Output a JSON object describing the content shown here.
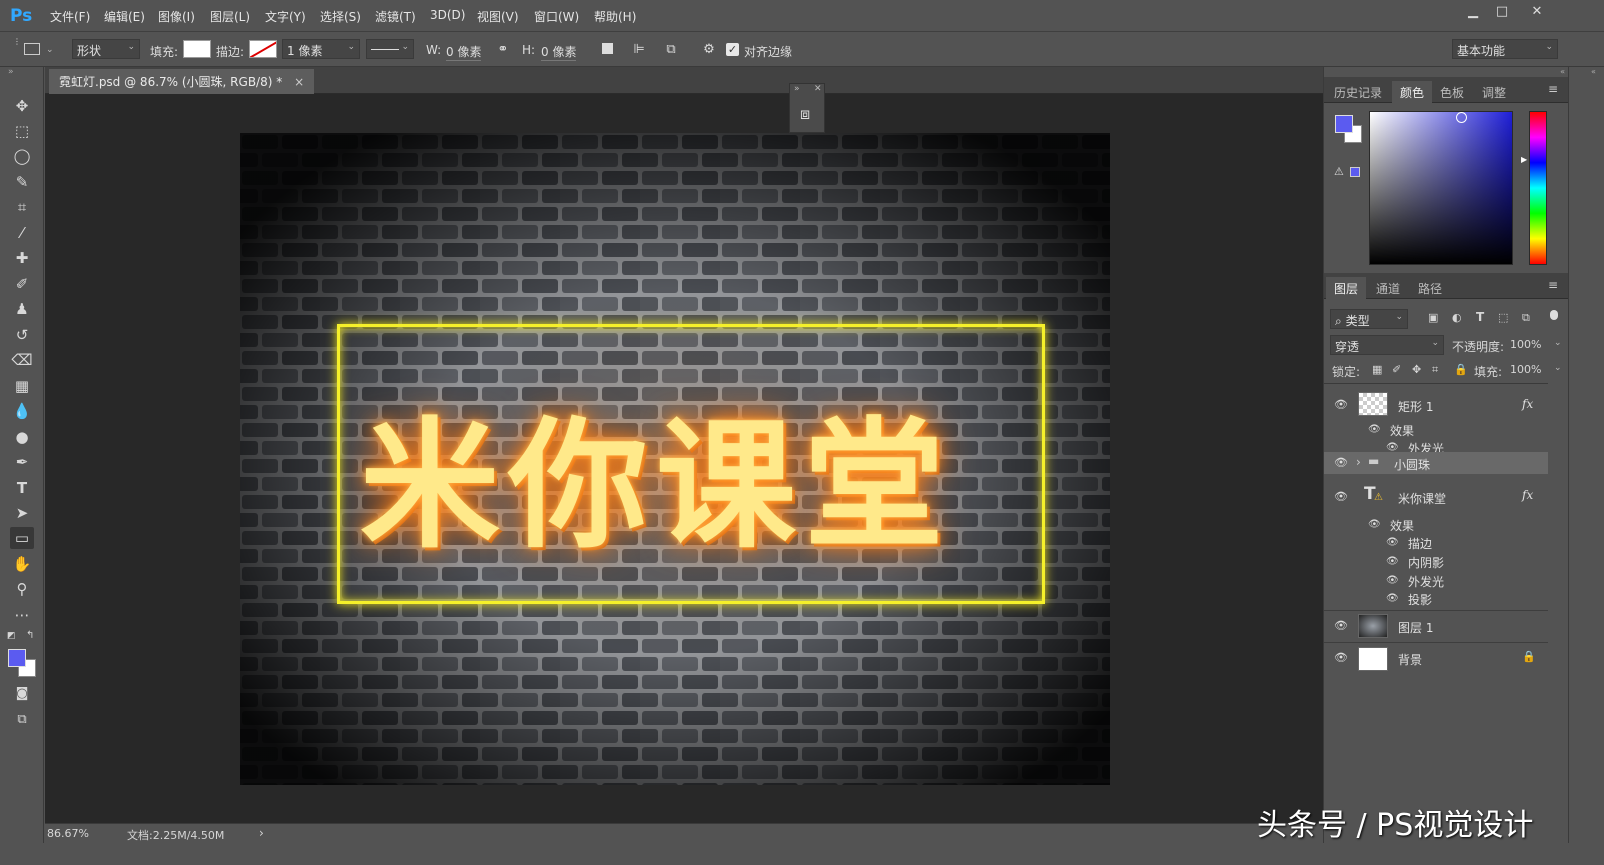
{
  "app": {
    "logo": "Ps"
  },
  "menu": [
    "文件(F)",
    "编辑(E)",
    "图像(I)",
    "图层(L)",
    "文字(Y)",
    "选择(S)",
    "滤镜(T)",
    "3D(D)",
    "视图(V)",
    "窗口(W)",
    "帮助(H)"
  ],
  "window_controls": {
    "minimize": "▁",
    "maximize": "□",
    "close": "✕"
  },
  "options": {
    "shape_mode": "形状",
    "fill_label": "填充:",
    "stroke_label": "描边:",
    "stroke_width": "1 像素",
    "w_label": "W:",
    "w_value": "0 像素",
    "h_label": "H:",
    "h_value": "0 像素",
    "align_edges": "对齐边缘",
    "workspace": "基本功能"
  },
  "document": {
    "tab_title": "霓虹灯.psd @ 86.7% (小圆珠, RGB/8) *",
    "tab_close": "×",
    "canvas_text": "米你课堂",
    "zoom": "86.67%",
    "doc_size": "文档:2.25M/4.50M",
    "status_arrow": "›"
  },
  "panels": {
    "top_tabs": [
      "历史记录",
      "颜色",
      "色板",
      "调整"
    ],
    "layer_tabs": [
      "图层",
      "通道",
      "路径"
    ],
    "filter_kind": "类型",
    "blend_mode": "穿透",
    "opacity_label": "不透明度:",
    "opacity_value": "100%",
    "lock_label": "锁定:",
    "fill_label": "填充:",
    "fill_value": "100%"
  },
  "layers": {
    "rect": {
      "name": "矩形 1",
      "fx": "fx",
      "effects_label": "效果",
      "effects": [
        "外发光"
      ]
    },
    "group": {
      "name": "小圆珠",
      "chevron": "›"
    },
    "text": {
      "name": "米你课堂",
      "fx": "fx",
      "effects_label": "效果",
      "effects": [
        "描边",
        "内阴影",
        "外发光",
        "投影"
      ]
    },
    "layer1": {
      "name": "图层 1"
    },
    "background": {
      "name": "背景"
    }
  },
  "colors": {
    "foreground": "#5b5bf0",
    "background": "#ffffff",
    "canvas_text": "#ffe98a",
    "neon_frame": "#f5f02a"
  },
  "watermark": "头条号 / PS视觉设计"
}
